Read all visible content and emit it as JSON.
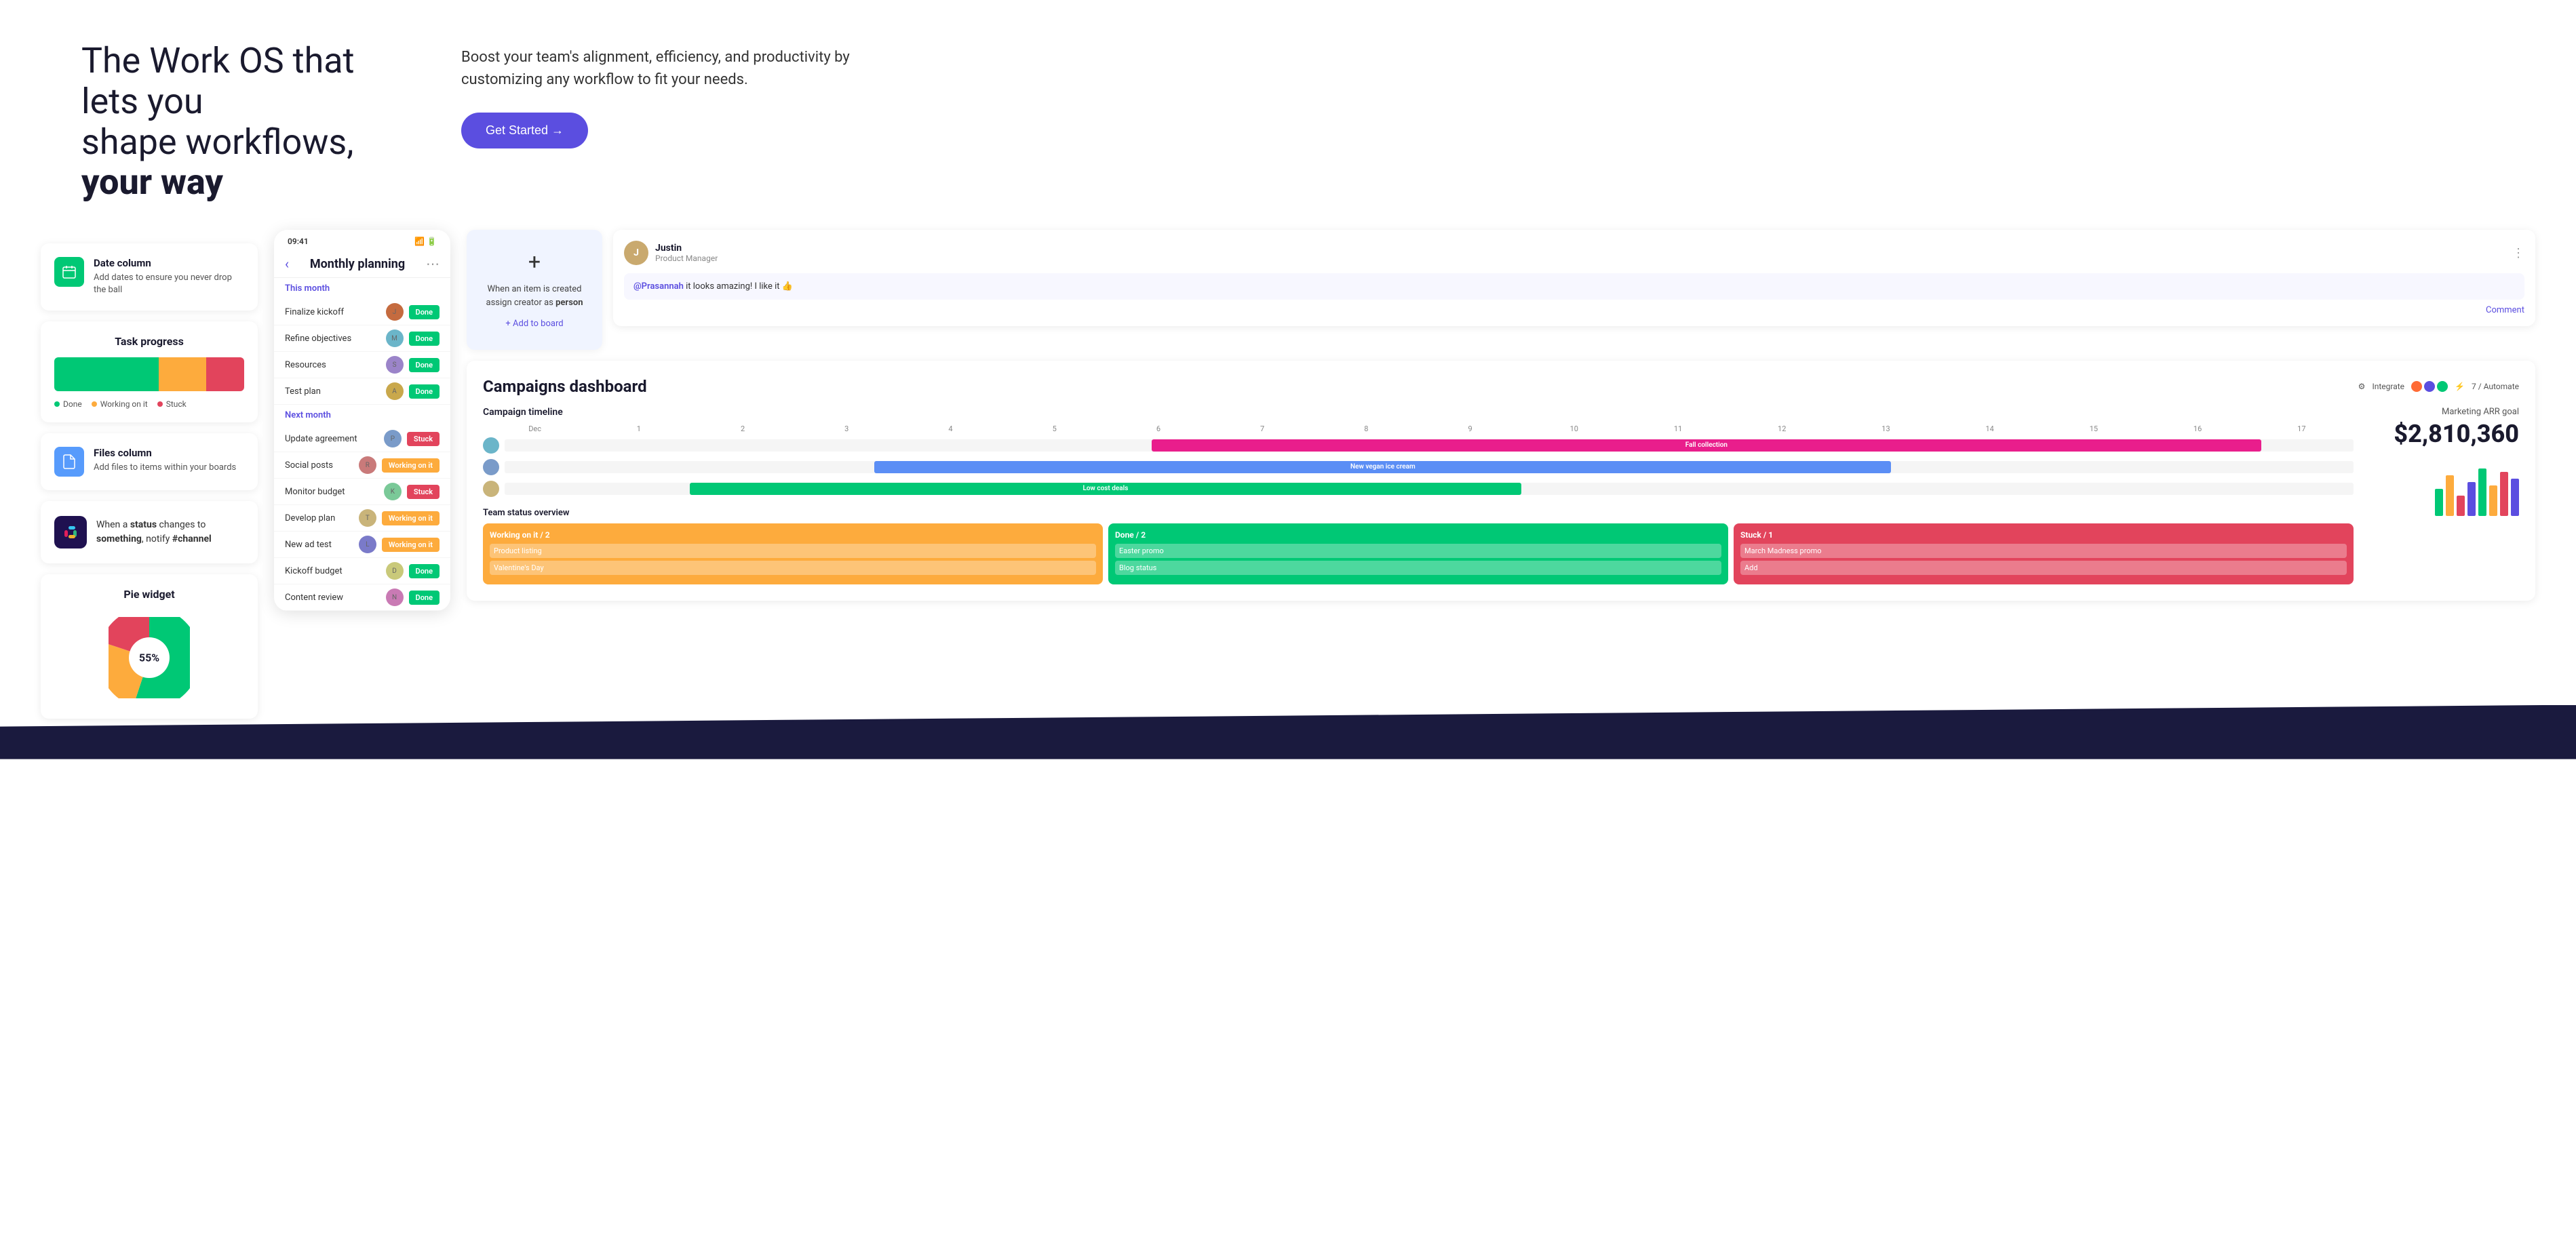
{
  "hero": {
    "title_part1": "The Work OS that lets you",
    "title_part2": "shape workflows, ",
    "title_bold": "your way",
    "subtitle": "Boost your team's alignment, efficiency, and productivity by customizing any workflow to fit your needs.",
    "cta_button": "Get Started →"
  },
  "feature_cards": {
    "date_column": {
      "title": "Date column",
      "description": "Add dates to ensure you never drop the ball"
    },
    "files_column": {
      "title": "Files column",
      "description": "Add files to items within your boards"
    }
  },
  "task_progress": {
    "title": "Task progress",
    "legend": {
      "done": "Done",
      "working": "Working on it",
      "stuck": "Stuck"
    }
  },
  "automation": {
    "text_intro": "When a ",
    "text_status": "status",
    "text_changes": " changes to ",
    "text_something": "something",
    "text_notify": ", notify ",
    "text_channel": "#channel"
  },
  "pie_widget": {
    "title": "Pie widget",
    "percentage": "55%"
  },
  "mobile_app": {
    "time": "09:41",
    "title": "Monthly planning",
    "this_month_label": "This month",
    "next_month_label": "Next month",
    "tasks": [
      {
        "name": "Finalize kickoff",
        "avatar": "av1",
        "status": "Done",
        "type": "done"
      },
      {
        "name": "Refine objectives",
        "avatar": "av2",
        "status": "Done",
        "type": "done"
      },
      {
        "name": "Resources",
        "avatar": "av3",
        "status": "Done",
        "type": "done"
      },
      {
        "name": "Test plan",
        "avatar": "av4",
        "status": "Done",
        "type": "done"
      },
      {
        "name": "Update agreement",
        "avatar": "av5",
        "status": "Stuck",
        "type": "stuck"
      },
      {
        "name": "Social posts",
        "avatar": "av6",
        "status": "Working on it",
        "type": "working"
      },
      {
        "name": "Monitor budget",
        "avatar": "av7",
        "status": "Stuck",
        "type": "stuck"
      },
      {
        "name": "Develop plan",
        "avatar": "av8",
        "status": "Working on it",
        "type": "working"
      },
      {
        "name": "New ad test",
        "avatar": "av9",
        "status": "Working on it",
        "type": "working"
      },
      {
        "name": "Kickoff budget",
        "avatar": "av10",
        "status": "Done",
        "type": "done"
      },
      {
        "name": "Content review",
        "avatar": "av11",
        "status": "Done",
        "type": "done"
      }
    ]
  },
  "automation_widget": {
    "text": "When an item is created assign creator as ",
    "bold": "person",
    "add_to_board": "+ Add to board"
  },
  "comment": {
    "user": "Justin",
    "role": "Product Manager",
    "mention": "@Prasannah",
    "text": " it looks amazing! I like it 👍",
    "action": "Comment"
  },
  "campaigns": {
    "title": "Campaigns dashboard",
    "integrate": "Integrate",
    "automate": "7 / Automate",
    "timeline_title": "Campaign timeline",
    "timeline_months": [
      "Dec",
      "1",
      "2",
      "3",
      "4",
      "5",
      "6",
      "7",
      "8",
      "9",
      "10",
      "11",
      "12",
      "13",
      "14",
      "15",
      "16",
      "17"
    ],
    "bars": [
      {
        "label": "Fall collection",
        "color": "bar-pink",
        "left": "35%",
        "width": "55%"
      },
      {
        "label": "New vegan ice cream",
        "color": "bar-blue",
        "left": "25%",
        "width": "45%"
      },
      {
        "label": "Low cost deals",
        "color": "bar-green",
        "left": "15%",
        "width": "35%"
      }
    ],
    "arr_label": "Marketing ARR goal",
    "arr_value": "$2,810,360",
    "team_status_title_1": "Team status overview",
    "team_status_title_2": "Team status overview",
    "status_columns": [
      {
        "title": "Working on it / 2",
        "color": "card-working",
        "items": [
          "Product listing",
          "Valentine's Day"
        ]
      },
      {
        "title": "Done / 2",
        "color": "card-done",
        "items": [
          "Easter promo",
          "Blog status"
        ]
      },
      {
        "title": "Stuck / 1",
        "color": "card-stuck",
        "items": [
          "March Madness promo",
          "Add"
        ]
      }
    ]
  }
}
